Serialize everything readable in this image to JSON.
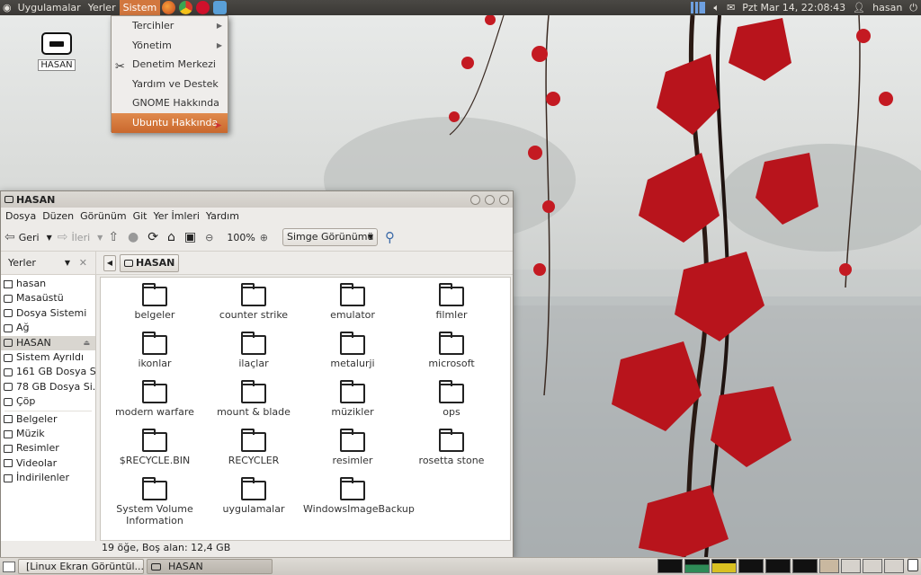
{
  "top_panel": {
    "menus": [
      "Uygulamalar",
      "Yerler",
      "Sistem"
    ],
    "clock": "Pzt Mar 14, 22:08:43",
    "user": "hasan"
  },
  "system_menu": {
    "items": [
      {
        "label": "Tercihler",
        "submenu": true
      },
      {
        "label": "Yönetim",
        "submenu": true
      },
      {
        "label": "Denetim Merkezi",
        "submenu": false
      },
      {
        "label": "Yardım ve Destek",
        "submenu": false
      },
      {
        "label": "GNOME Hakkında",
        "submenu": false
      },
      {
        "label": "Ubuntu Hakkında",
        "submenu": false
      }
    ]
  },
  "desktop": {
    "icon_label": "HASAN"
  },
  "file_manager": {
    "title": "HASAN",
    "menubar": [
      "Dosya",
      "Düzen",
      "Görünüm",
      "Git",
      "Yer İmleri",
      "Yardım"
    ],
    "toolbar": {
      "back": "Geri",
      "forward": "İleri",
      "zoom": "100%",
      "view_mode": "Simge Görünümü"
    },
    "sidebar_title": "Yerler",
    "breadcrumb": "HASAN",
    "sidebar": {
      "places": [
        "hasan",
        "Masaüstü",
        "Dosya Sistemi",
        "Ağ",
        "HASAN",
        "Sistem Ayrıldı",
        "161 GB Dosya S...",
        "78 GB Dosya Si...",
        "Çöp"
      ],
      "bookmarks": [
        "Belgeler",
        "Müzik",
        "Resimler",
        "Videolar",
        "İndirilenler"
      ]
    },
    "folders": [
      "belgeler",
      "counter strike",
      "emulator",
      "filmler",
      "ikonlar",
      "ilaçlar",
      "metalurji",
      "microsoft",
      "modern warfare",
      "mount & blade",
      "müzikler",
      "ops",
      "$RECYCLE.BIN",
      "RECYCLER",
      "resimler",
      "rosetta stone",
      "System Volume Information",
      "uygulamalar",
      "WindowsImageBackup"
    ],
    "status": "19 öğe, Boş alan: 12,4 GB"
  },
  "taskbar": {
    "tasks": [
      "[Linux Ekran Görüntül...",
      "HASAN"
    ]
  }
}
